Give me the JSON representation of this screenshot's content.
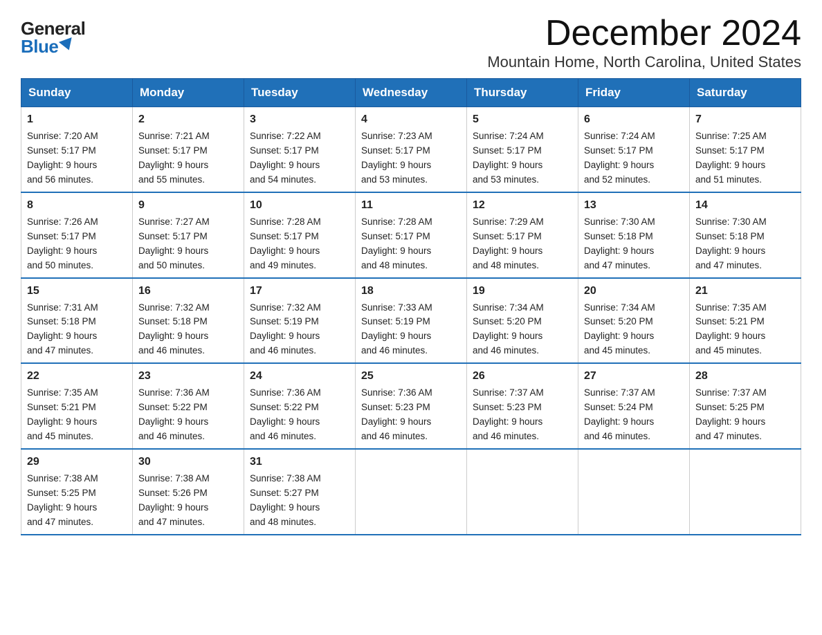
{
  "logo": {
    "general": "General",
    "blue": "Blue"
  },
  "title": "December 2024",
  "location": "Mountain Home, North Carolina, United States",
  "days_of_week": [
    "Sunday",
    "Monday",
    "Tuesday",
    "Wednesday",
    "Thursday",
    "Friday",
    "Saturday"
  ],
  "weeks": [
    [
      {
        "day": "1",
        "sunrise": "7:20 AM",
        "sunset": "5:17 PM",
        "daylight": "9 hours and 56 minutes."
      },
      {
        "day": "2",
        "sunrise": "7:21 AM",
        "sunset": "5:17 PM",
        "daylight": "9 hours and 55 minutes."
      },
      {
        "day": "3",
        "sunrise": "7:22 AM",
        "sunset": "5:17 PM",
        "daylight": "9 hours and 54 minutes."
      },
      {
        "day": "4",
        "sunrise": "7:23 AM",
        "sunset": "5:17 PM",
        "daylight": "9 hours and 53 minutes."
      },
      {
        "day": "5",
        "sunrise": "7:24 AM",
        "sunset": "5:17 PM",
        "daylight": "9 hours and 53 minutes."
      },
      {
        "day": "6",
        "sunrise": "7:24 AM",
        "sunset": "5:17 PM",
        "daylight": "9 hours and 52 minutes."
      },
      {
        "day": "7",
        "sunrise": "7:25 AM",
        "sunset": "5:17 PM",
        "daylight": "9 hours and 51 minutes."
      }
    ],
    [
      {
        "day": "8",
        "sunrise": "7:26 AM",
        "sunset": "5:17 PM",
        "daylight": "9 hours and 50 minutes."
      },
      {
        "day": "9",
        "sunrise": "7:27 AM",
        "sunset": "5:17 PM",
        "daylight": "9 hours and 50 minutes."
      },
      {
        "day": "10",
        "sunrise": "7:28 AM",
        "sunset": "5:17 PM",
        "daylight": "9 hours and 49 minutes."
      },
      {
        "day": "11",
        "sunrise": "7:28 AM",
        "sunset": "5:17 PM",
        "daylight": "9 hours and 48 minutes."
      },
      {
        "day": "12",
        "sunrise": "7:29 AM",
        "sunset": "5:17 PM",
        "daylight": "9 hours and 48 minutes."
      },
      {
        "day": "13",
        "sunrise": "7:30 AM",
        "sunset": "5:18 PM",
        "daylight": "9 hours and 47 minutes."
      },
      {
        "day": "14",
        "sunrise": "7:30 AM",
        "sunset": "5:18 PM",
        "daylight": "9 hours and 47 minutes."
      }
    ],
    [
      {
        "day": "15",
        "sunrise": "7:31 AM",
        "sunset": "5:18 PM",
        "daylight": "9 hours and 47 minutes."
      },
      {
        "day": "16",
        "sunrise": "7:32 AM",
        "sunset": "5:18 PM",
        "daylight": "9 hours and 46 minutes."
      },
      {
        "day": "17",
        "sunrise": "7:32 AM",
        "sunset": "5:19 PM",
        "daylight": "9 hours and 46 minutes."
      },
      {
        "day": "18",
        "sunrise": "7:33 AM",
        "sunset": "5:19 PM",
        "daylight": "9 hours and 46 minutes."
      },
      {
        "day": "19",
        "sunrise": "7:34 AM",
        "sunset": "5:20 PM",
        "daylight": "9 hours and 46 minutes."
      },
      {
        "day": "20",
        "sunrise": "7:34 AM",
        "sunset": "5:20 PM",
        "daylight": "9 hours and 45 minutes."
      },
      {
        "day": "21",
        "sunrise": "7:35 AM",
        "sunset": "5:21 PM",
        "daylight": "9 hours and 45 minutes."
      }
    ],
    [
      {
        "day": "22",
        "sunrise": "7:35 AM",
        "sunset": "5:21 PM",
        "daylight": "9 hours and 45 minutes."
      },
      {
        "day": "23",
        "sunrise": "7:36 AM",
        "sunset": "5:22 PM",
        "daylight": "9 hours and 46 minutes."
      },
      {
        "day": "24",
        "sunrise": "7:36 AM",
        "sunset": "5:22 PM",
        "daylight": "9 hours and 46 minutes."
      },
      {
        "day": "25",
        "sunrise": "7:36 AM",
        "sunset": "5:23 PM",
        "daylight": "9 hours and 46 minutes."
      },
      {
        "day": "26",
        "sunrise": "7:37 AM",
        "sunset": "5:23 PM",
        "daylight": "9 hours and 46 minutes."
      },
      {
        "day": "27",
        "sunrise": "7:37 AM",
        "sunset": "5:24 PM",
        "daylight": "9 hours and 46 minutes."
      },
      {
        "day": "28",
        "sunrise": "7:37 AM",
        "sunset": "5:25 PM",
        "daylight": "9 hours and 47 minutes."
      }
    ],
    [
      {
        "day": "29",
        "sunrise": "7:38 AM",
        "sunset": "5:25 PM",
        "daylight": "9 hours and 47 minutes."
      },
      {
        "day": "30",
        "sunrise": "7:38 AM",
        "sunset": "5:26 PM",
        "daylight": "9 hours and 47 minutes."
      },
      {
        "day": "31",
        "sunrise": "7:38 AM",
        "sunset": "5:27 PM",
        "daylight": "9 hours and 48 minutes."
      },
      null,
      null,
      null,
      null
    ]
  ],
  "labels": {
    "sunrise": "Sunrise:",
    "sunset": "Sunset:",
    "daylight": "Daylight:"
  }
}
